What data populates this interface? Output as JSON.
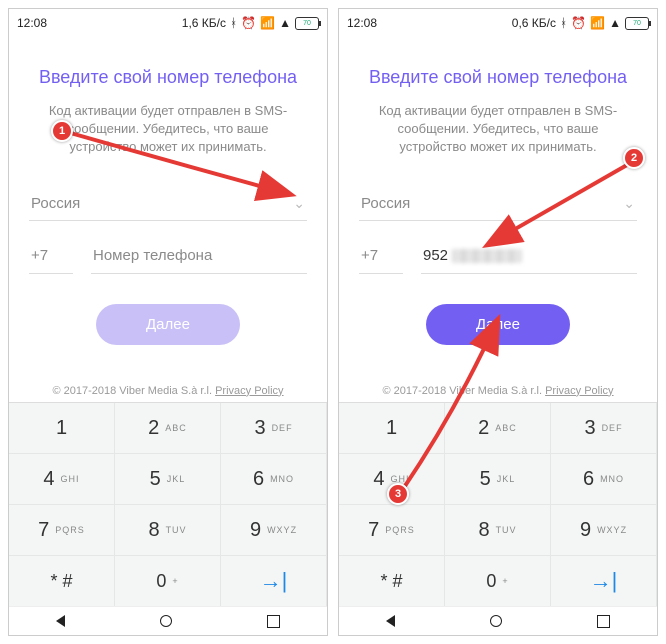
{
  "screens": [
    {
      "status": {
        "time": "12:08",
        "net": "1,6 КБ/с",
        "battery": "70"
      },
      "title": "Введите свой номер телефона",
      "subtitle": "Код активации будет отправлен в SMS-сообщении. Убедитесь, что ваше устройство может их принимать.",
      "country": "Россия",
      "cc": "+7",
      "phone_placeholder": "Номер телефона",
      "phone_entered": "",
      "phone_blurred": false,
      "next_label": "Далее",
      "next_enabled": false,
      "footer_copy": "© 2017-2018 Viber Media S.à r.l. ",
      "footer_pp": "Privacy Policy"
    },
    {
      "status": {
        "time": "12:08",
        "net": "0,6 КБ/с",
        "battery": "70"
      },
      "title": "Введите свой номер телефона",
      "subtitle": "Код активации будет отправлен в SMS-сообщении. Убедитесь, что ваше устройство может их принимать.",
      "country": "Россия",
      "cc": "+7",
      "phone_placeholder": "",
      "phone_entered": "952",
      "phone_blurred": true,
      "next_label": "Далее",
      "next_enabled": true,
      "footer_copy": "© 2017-2018 Viber Media S.à r.l. ",
      "footer_pp": "Privacy Policy"
    }
  ],
  "keypad": [
    {
      "d": "1",
      "l": ""
    },
    {
      "d": "2",
      "l": "ABC"
    },
    {
      "d": "3",
      "l": "DEF"
    },
    {
      "d": "4",
      "l": "GHI"
    },
    {
      "d": "5",
      "l": "JKL"
    },
    {
      "d": "6",
      "l": "MNO"
    },
    {
      "d": "7",
      "l": "PQRS"
    },
    {
      "d": "8",
      "l": "TUV"
    },
    {
      "d": "9",
      "l": "WXYZ"
    },
    {
      "d": "* #",
      "l": ""
    },
    {
      "d": "0",
      "l": "+"
    },
    {
      "d": "→|",
      "l": ""
    }
  ],
  "badges": [
    "1",
    "2",
    "3"
  ],
  "annot_color": "#e53935"
}
